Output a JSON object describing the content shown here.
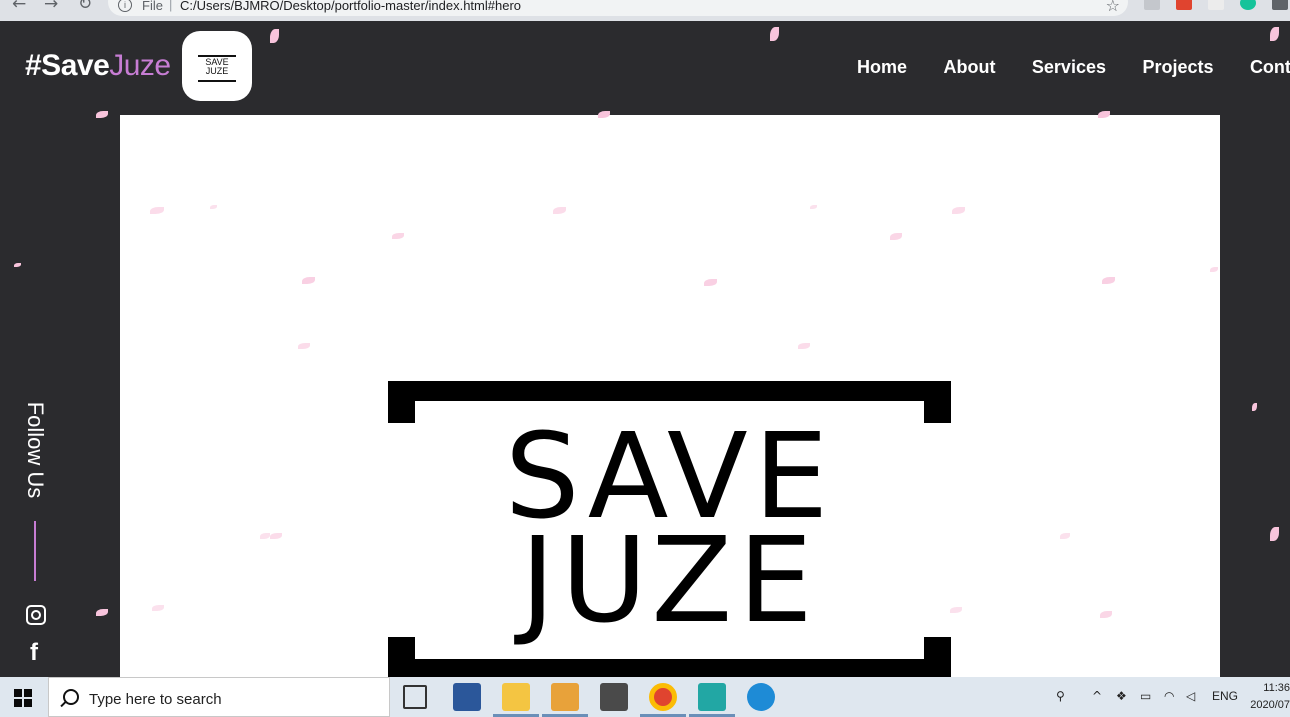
{
  "browser": {
    "scheme_label": "File",
    "url": "C:/Users/BJMRO/Desktop/portfolio-master/index.html#hero"
  },
  "site": {
    "brand_main": "#Save",
    "brand_accent": "Juze",
    "logo_badge_line1": "SAVE",
    "logo_badge_line2": "JUZE",
    "nav": [
      "Home",
      "About",
      "Services",
      "Projects",
      "Contac"
    ],
    "hero_logo_line1": "SAVE",
    "hero_logo_line2": "JUZE",
    "follow_label": "Follow Us",
    "social": [
      "instagram-icon",
      "facebook-icon"
    ]
  },
  "taskbar": {
    "search_placeholder": "Type here to search",
    "apps": [
      "task-view-icon",
      "word-icon",
      "file-explorer-icon",
      "media-player-icon",
      "sublime-text-icon",
      "chrome-icon",
      "visual-studio-icon",
      "edge-icon"
    ],
    "language": "ENG",
    "time": "11:36",
    "date": "2020/07"
  },
  "colors": {
    "page_bg": "#2b2b2e",
    "accent": "#c77dd4",
    "petal": "#f8c4dc"
  }
}
